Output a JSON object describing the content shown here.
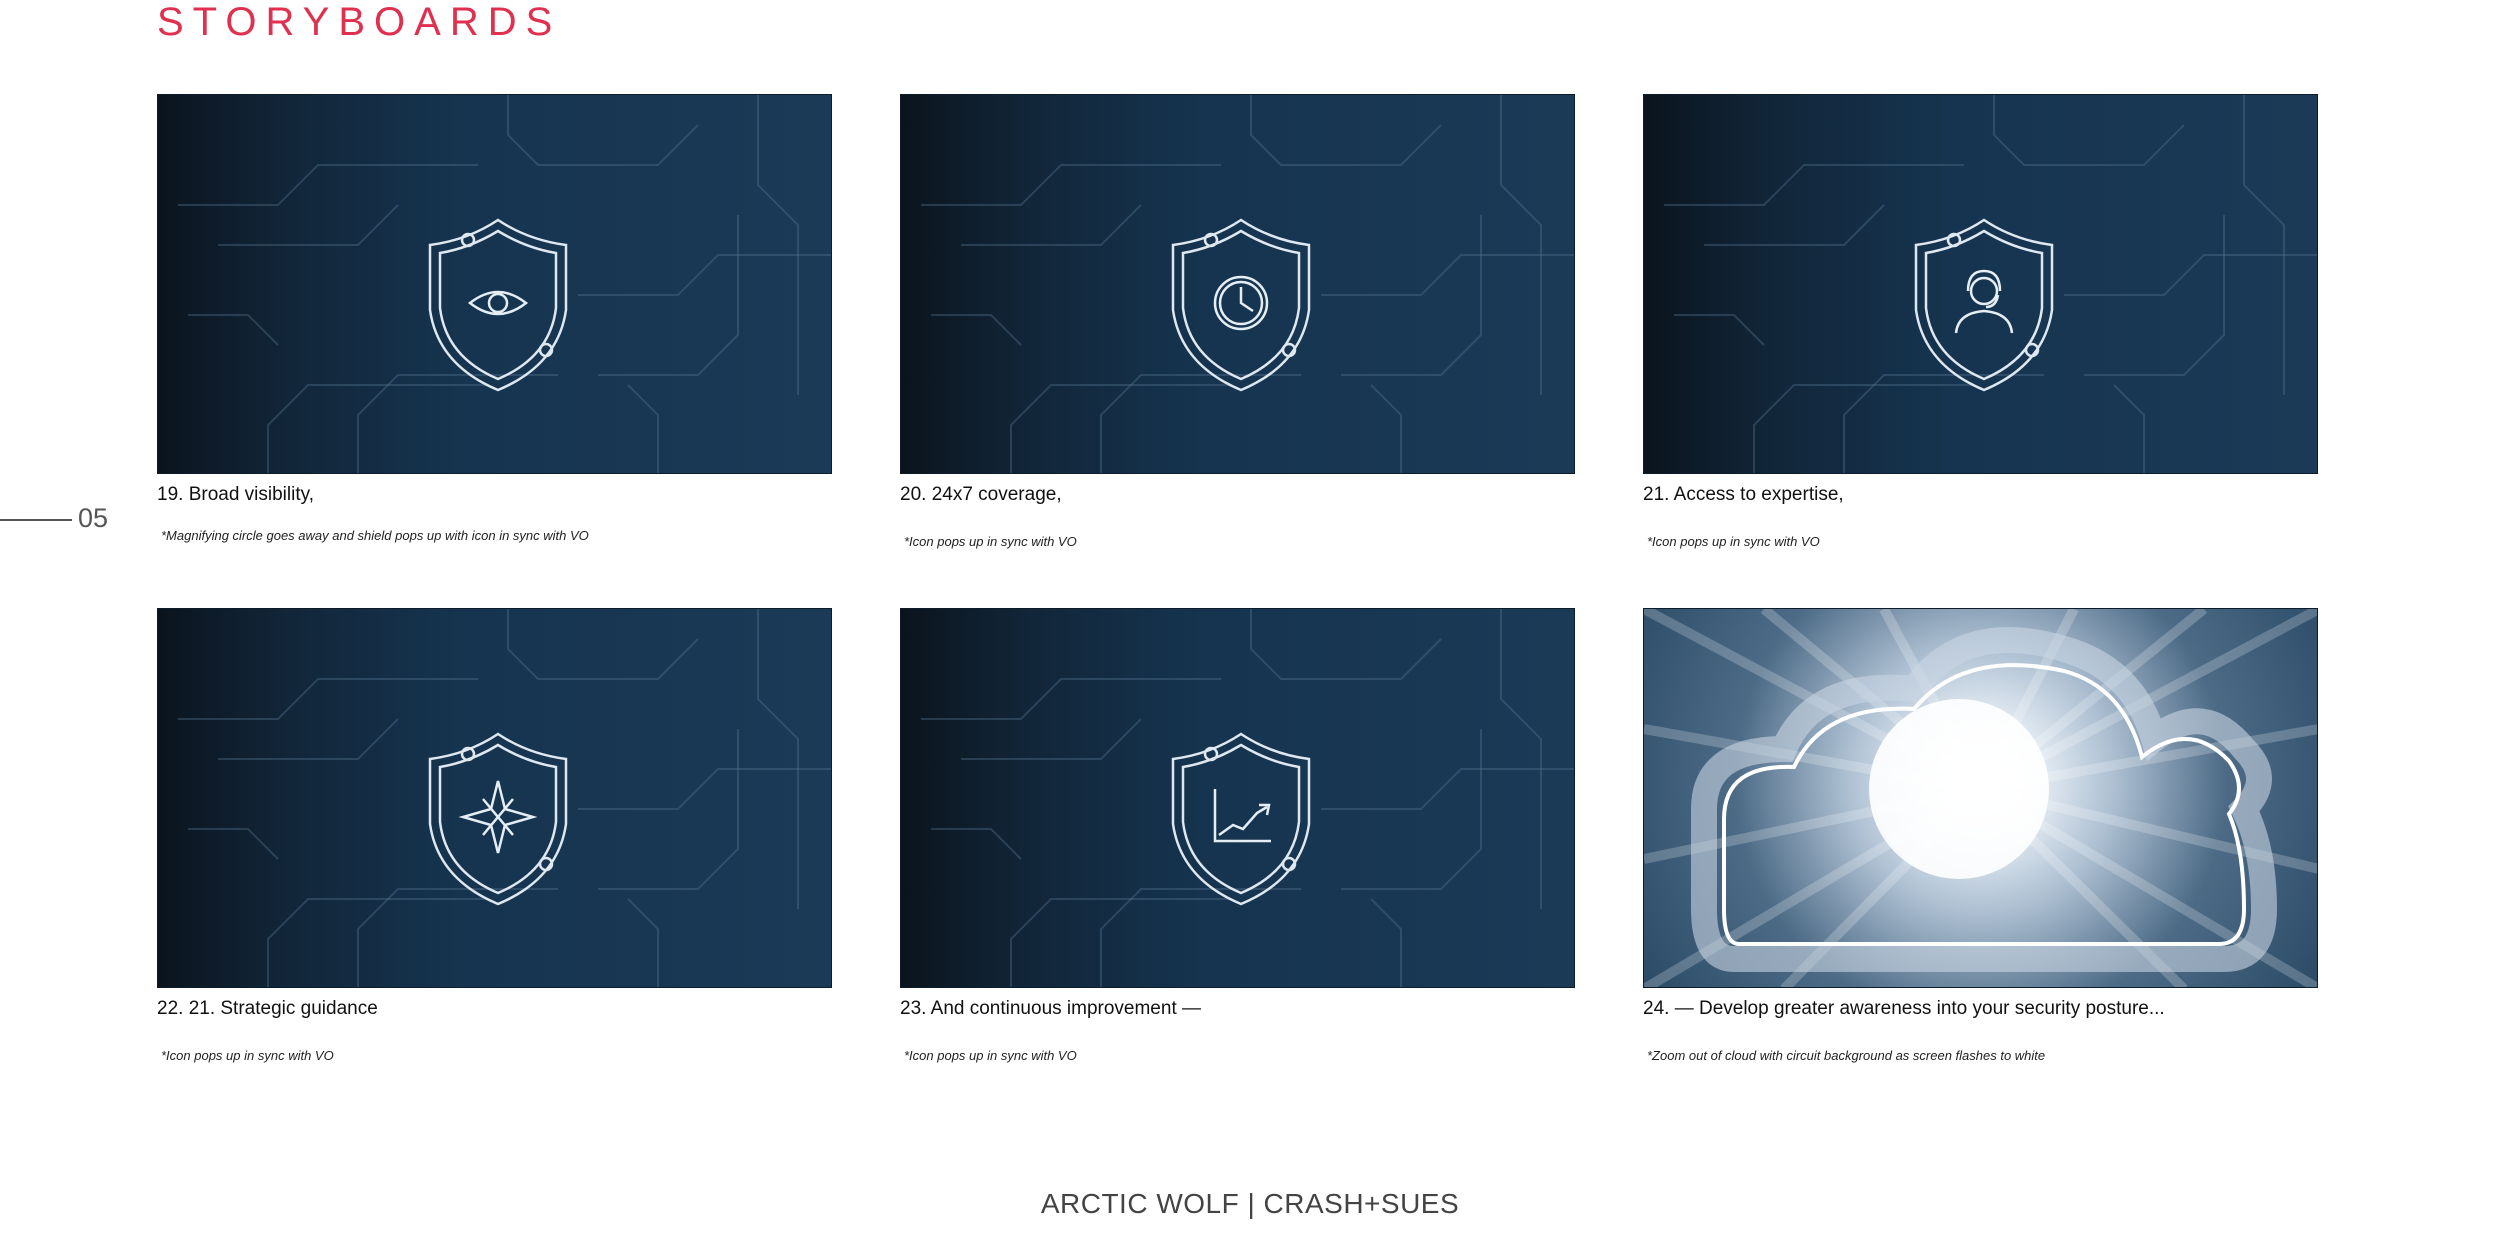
{
  "header": {
    "title": "STORYBOARDS"
  },
  "page_number": "05",
  "frames": [
    {
      "caption": "19. Broad visibility,",
      "note": "*Magnifying circle goes away and shield pops up with icon in sync with VO",
      "icon": "eye-icon"
    },
    {
      "caption": "20. 24x7 coverage,",
      "note": "*Icon pops up in sync with VO",
      "icon": "clock-icon"
    },
    {
      "caption": "21. Access to expertise,",
      "note": "*Icon pops up in sync with VO",
      "icon": "headset-person-icon"
    },
    {
      "caption": "22. 21. Strategic guidance",
      "note": "*Icon pops up in sync with VO",
      "icon": "compass-star-icon"
    },
    {
      "caption": "23. And continuous improvement —",
      "note": "*Icon pops up in sync with VO",
      "icon": "growth-chart-icon"
    },
    {
      "caption": "24. — Develop greater awareness into your security posture...",
      "note": "*Zoom out of cloud with circuit background as screen flashes to white",
      "icon": "glowing-cloud-icon"
    }
  ],
  "footer": {
    "text": "ARCTIC WOLF | CRASH+SUES"
  },
  "colors": {
    "accent": "#e0304f",
    "frame_bg": "#16344f"
  }
}
